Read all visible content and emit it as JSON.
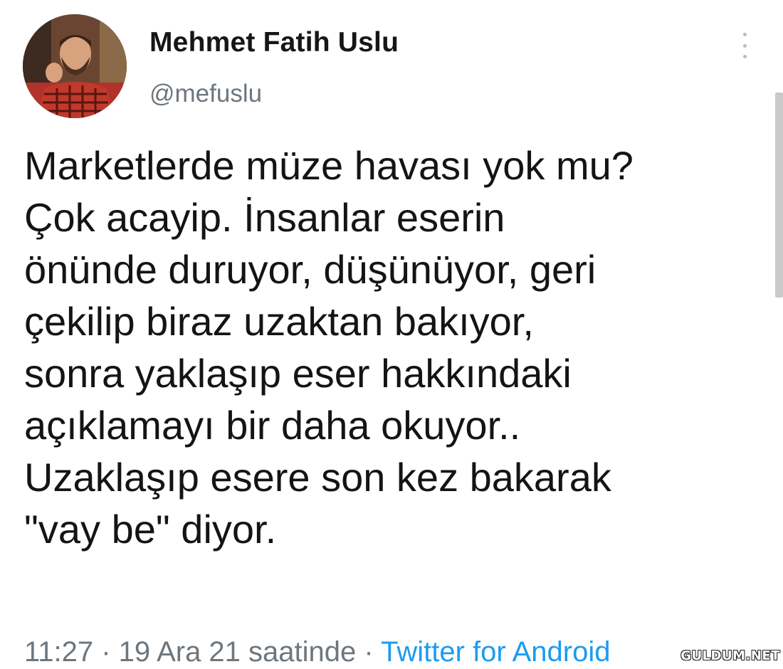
{
  "author": {
    "name": "Mehmet Fatih Uslu",
    "handle": "@mefuslu"
  },
  "tweet": {
    "lines": [
      "Marketlerde müze havası yok mu?",
      "Çok acayip. İnsanlar eserin",
      "önünde duruyor, düşünüyor, geri",
      "çekilip biraz uzaktan bakıyor,",
      "sonra yaklaşıp eser hakkındaki",
      "açıklamayı bir daha okuyor..",
      "Uzaklaşıp esere son kez bakarak",
      "\"vay be\" diyor."
    ],
    "timestamp": "11:27 · 19 Ara 21 saatinde · ",
    "source": "Twitter for Android"
  },
  "watermark": "GULDUM.NET",
  "icons": {
    "more": "more-vertical-icon"
  },
  "colors": {
    "text": "#141414",
    "muted": "#6e767d",
    "link": "#1d9bf0"
  }
}
